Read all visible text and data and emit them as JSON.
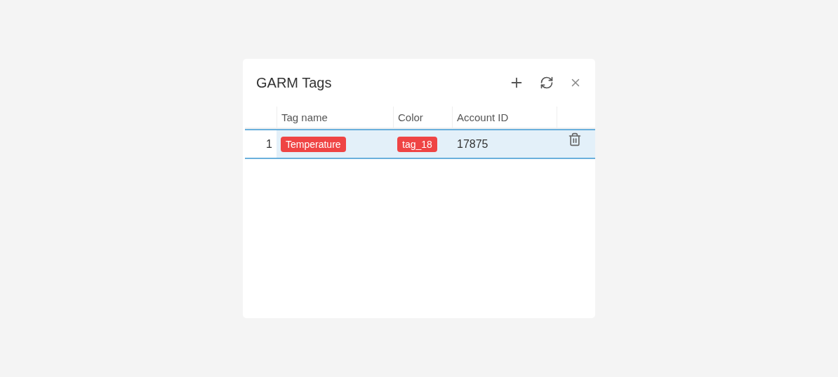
{
  "dialog": {
    "title": "GARM Tags"
  },
  "table": {
    "columns": [
      "Tag name",
      "Color",
      "Account ID"
    ],
    "rows": [
      {
        "number": "1",
        "tag_name": {
          "text": "Temperature",
          "color": "#ef4444"
        },
        "color": {
          "text": "tag_18",
          "color": "#ef4444"
        },
        "account_id": "17875",
        "selected": true
      }
    ]
  }
}
